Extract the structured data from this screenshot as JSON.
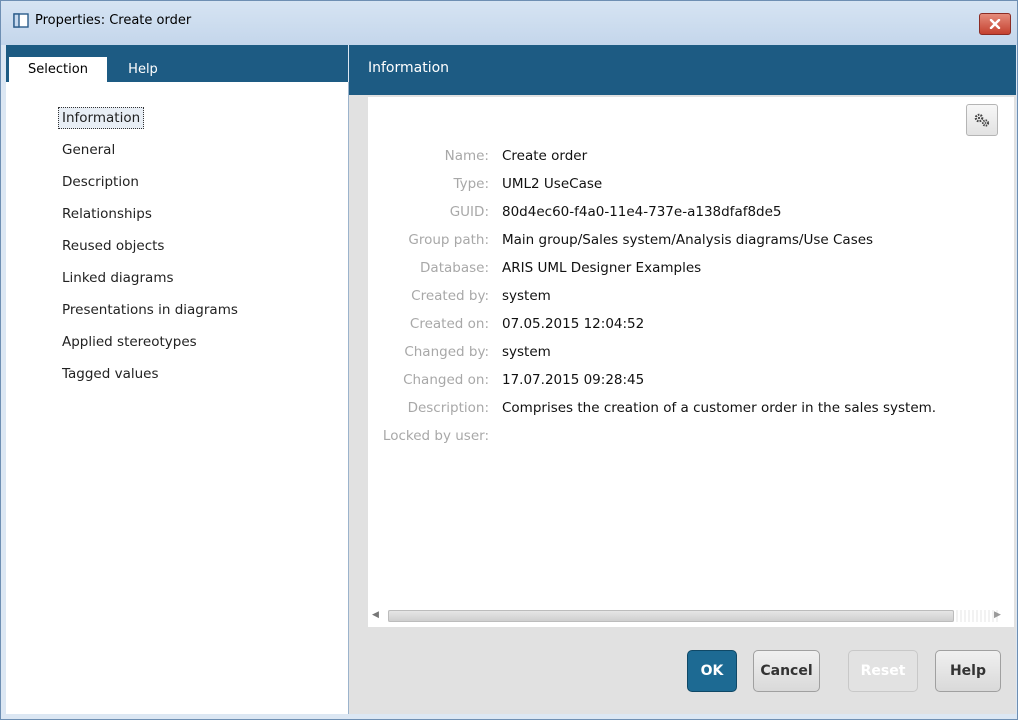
{
  "window": {
    "title": "Properties: Create order",
    "close_icon": "close-icon"
  },
  "left": {
    "tabs": [
      {
        "label": "Selection",
        "active": true
      },
      {
        "label": "Help",
        "active": false
      }
    ],
    "nav_items": [
      {
        "label": "Information",
        "selected": true
      },
      {
        "label": "General"
      },
      {
        "label": "Description"
      },
      {
        "label": "Relationships"
      },
      {
        "label": "Reused objects"
      },
      {
        "label": "Linked diagrams"
      },
      {
        "label": "Presentations in diagrams"
      },
      {
        "label": "Applied stereotypes"
      },
      {
        "label": "Tagged values"
      }
    ]
  },
  "right": {
    "header": "Information",
    "settings_icon": "gears-icon",
    "properties": [
      {
        "label": "Name:",
        "value": "Create order"
      },
      {
        "label": "Type:",
        "value": "UML2 UseCase"
      },
      {
        "label": "GUID:",
        "value": "80d4ec60-f4a0-11e4-737e-a138dfaf8de5"
      },
      {
        "label": "Group path:",
        "value": "Main group/Sales system/Analysis diagrams/Use Cases"
      },
      {
        "label": "Database:",
        "value": "ARIS UML Designer Examples"
      },
      {
        "label": "Created by:",
        "value": "system"
      },
      {
        "label": "Created on:",
        "value": "07.05.2015 12:04:52"
      },
      {
        "label": "Changed by:",
        "value": "system"
      },
      {
        "label": "Changed on:",
        "value": "17.07.2015 09:28:45"
      },
      {
        "label": "Description:",
        "value": "Comprises the creation of a customer order in the sales system."
      },
      {
        "label": "Locked by user:",
        "value": ""
      }
    ]
  },
  "buttons": {
    "ok": "OK",
    "cancel": "Cancel",
    "reset": "Reset",
    "reset_enabled": false,
    "help": "Help"
  }
}
